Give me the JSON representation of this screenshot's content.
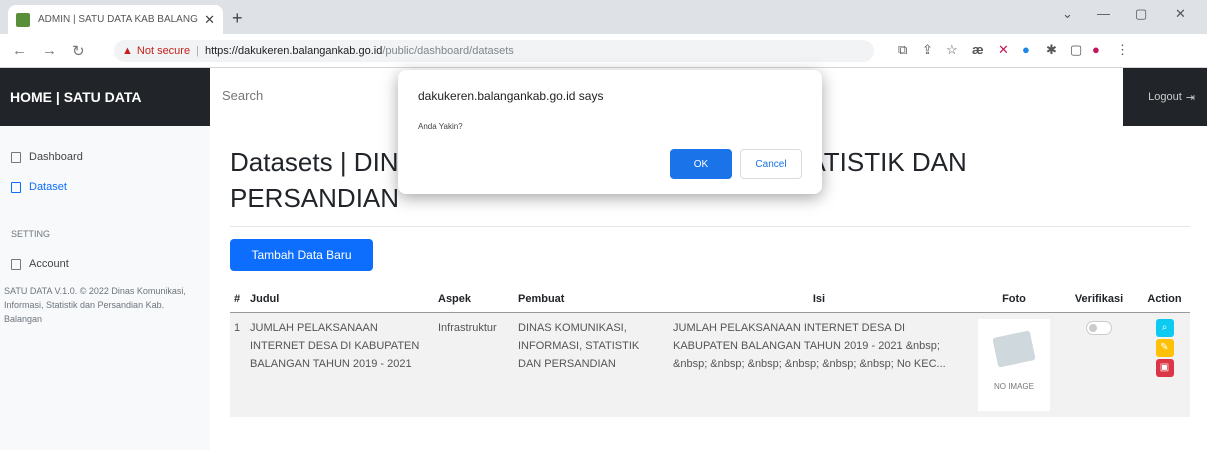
{
  "browser": {
    "tab_title": "ADMIN | SATU DATA KAB BALANGAN",
    "new_tab_icon": "plus-icon",
    "address": {
      "warning_label": "Not secure",
      "url_host": "https://dakukeren.balangankab.go.id",
      "url_path": "/public/dashboard/datasets"
    }
  },
  "header": {
    "brand": "HOME | SATU DATA",
    "search_placeholder": "Search",
    "logout_label": "Logout"
  },
  "sidebar": {
    "items": [
      {
        "label": "Dashboard",
        "icon": "home-icon"
      },
      {
        "label": "Dataset",
        "icon": "file-icon"
      }
    ],
    "settings_heading": "SETTING",
    "settings_items": [
      {
        "label": "Account",
        "icon": "file-icon"
      }
    ],
    "footnote": "SATU DATA V.1.0. © 2022 Dinas Komunikasi, Informasi, Statistik dan Persandian Kab. Balangan"
  },
  "main": {
    "title": "Datasets | DINAS KOMUNIKASI, INFORMASI, STATISTIK DAN PERSANDIAN",
    "add_button": "Tambah Data Baru",
    "table": {
      "columns": [
        "#",
        "Judul",
        "Aspek",
        "Pembuat",
        "Isi",
        "Foto",
        "Verifikasi",
        "Action"
      ],
      "rows": [
        {
          "no": "1",
          "judul": "JUMLAH PELAKSANAAN INTERNET DESA DI KABUPATEN BALANGAN TAHUN 2019 - 2021",
          "aspek": "Infrastruktur",
          "pembuat": "DINAS KOMUNIKASI, INFORMASI, STATISTIK DAN PERSANDIAN",
          "isi": "JUMLAH PELAKSANAAN INTERNET DESA DI KABUPATEN BALANGAN TAHUN 2019 - 2021 &nbsp; &nbsp; &nbsp; &nbsp; &nbsp; &nbsp; &nbsp; No KEC...",
          "foto_caption": "NO IMAGE"
        }
      ]
    }
  },
  "dialog": {
    "title": "dakukeren.balangankab.go.id says",
    "message": "Anda Yakin?",
    "ok_label": "OK",
    "cancel_label": "Cancel"
  },
  "colors": {
    "primary": "#0d6efd",
    "dark": "#212529",
    "info": "#0dcaf0",
    "warning": "#ffc107",
    "danger": "#dc3545"
  }
}
